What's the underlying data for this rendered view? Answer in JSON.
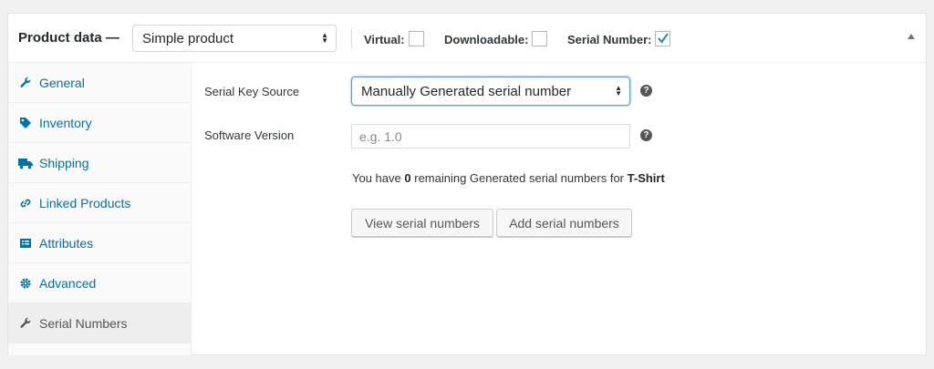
{
  "header": {
    "title": "Product data —",
    "product_type": "Simple product",
    "virtual_label": "Virtual:",
    "downloadable_label": "Downloadable:",
    "serial_number_label": "Serial Number:"
  },
  "tabs": [
    {
      "label": "General",
      "icon": "wrench-icon"
    },
    {
      "label": "Inventory",
      "icon": "tag-icon"
    },
    {
      "label": "Shipping",
      "icon": "truck-icon"
    },
    {
      "label": "Linked Products",
      "icon": "link-icon"
    },
    {
      "label": "Attributes",
      "icon": "list-icon"
    },
    {
      "label": "Advanced",
      "icon": "gear-icon"
    },
    {
      "label": "Serial Numbers",
      "icon": "wrench-icon"
    }
  ],
  "content": {
    "serial_key_source_label": "Serial Key Source",
    "serial_key_source_value": "Manually Generated serial number",
    "software_version_label": "Software Version",
    "software_version_placeholder": "e.g. 1.0",
    "info_prefix": "You have",
    "info_count": "0",
    "info_middle": "remaining Generated serial numbers for",
    "info_product": "T-Shirt",
    "view_button": "View serial numbers",
    "add_button": "Add serial numbers",
    "help_glyph": "?"
  },
  "colors": {
    "link": "#0073aa",
    "active_tab_bg": "#eeeeee",
    "check": "#1e8cbe"
  }
}
